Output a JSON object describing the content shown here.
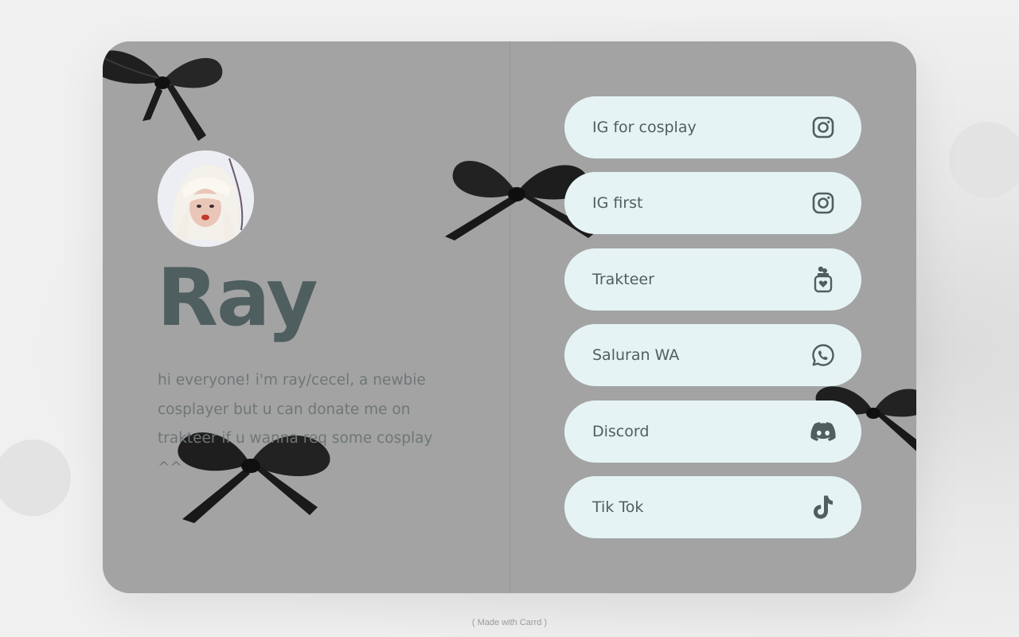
{
  "profile": {
    "name": "Ray",
    "bio": "hi everyone! i'm ray/cecel, a newbie cosplayer but u can donate me on trakteer if u wanna req some cosplay ^^"
  },
  "links": [
    {
      "label": "IG for cosplay",
      "icon": "instagram-icon"
    },
    {
      "label": "IG first",
      "icon": "instagram-icon"
    },
    {
      "label": "Trakteer",
      "icon": "trakteer-icon"
    },
    {
      "label": "Saluran WA",
      "icon": "whatsapp-icon"
    },
    {
      "label": "Discord",
      "icon": "discord-icon"
    },
    {
      "label": "Tik Tok",
      "icon": "tiktok-icon"
    }
  ],
  "footer": {
    "text": "( Made with Carrd )"
  },
  "colors": {
    "card_background": "#a3a3a3",
    "button_background": "#e5f3f4",
    "text_dark": "#4f5e5f",
    "bio_text": "#6f7677"
  }
}
